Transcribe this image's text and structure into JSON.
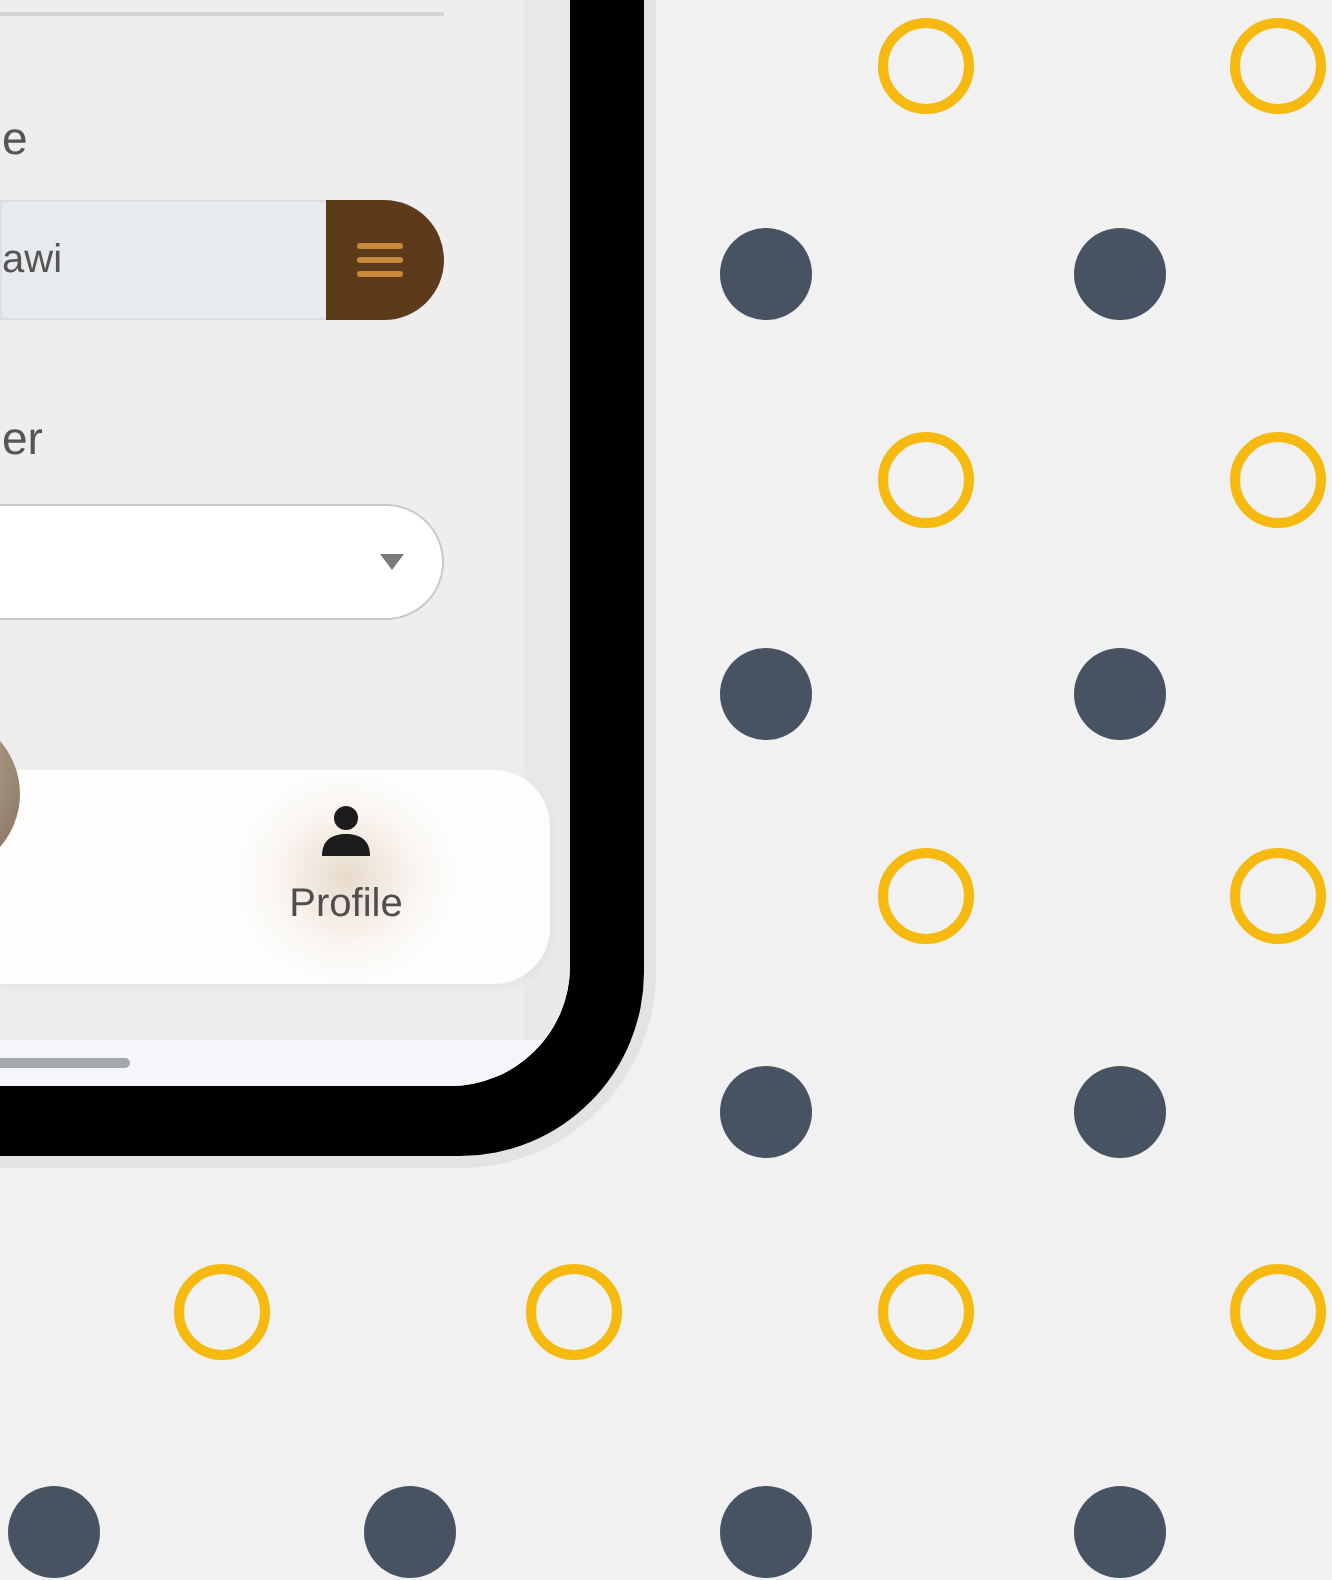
{
  "form": {
    "fields": [
      {
        "kind": "text",
        "label": "e",
        "value": "awi"
      },
      {
        "kind": "select",
        "label": "er"
      }
    ]
  },
  "bottom_nav": {
    "items": [
      {
        "label": "Profile",
        "selected": true
      }
    ]
  }
}
